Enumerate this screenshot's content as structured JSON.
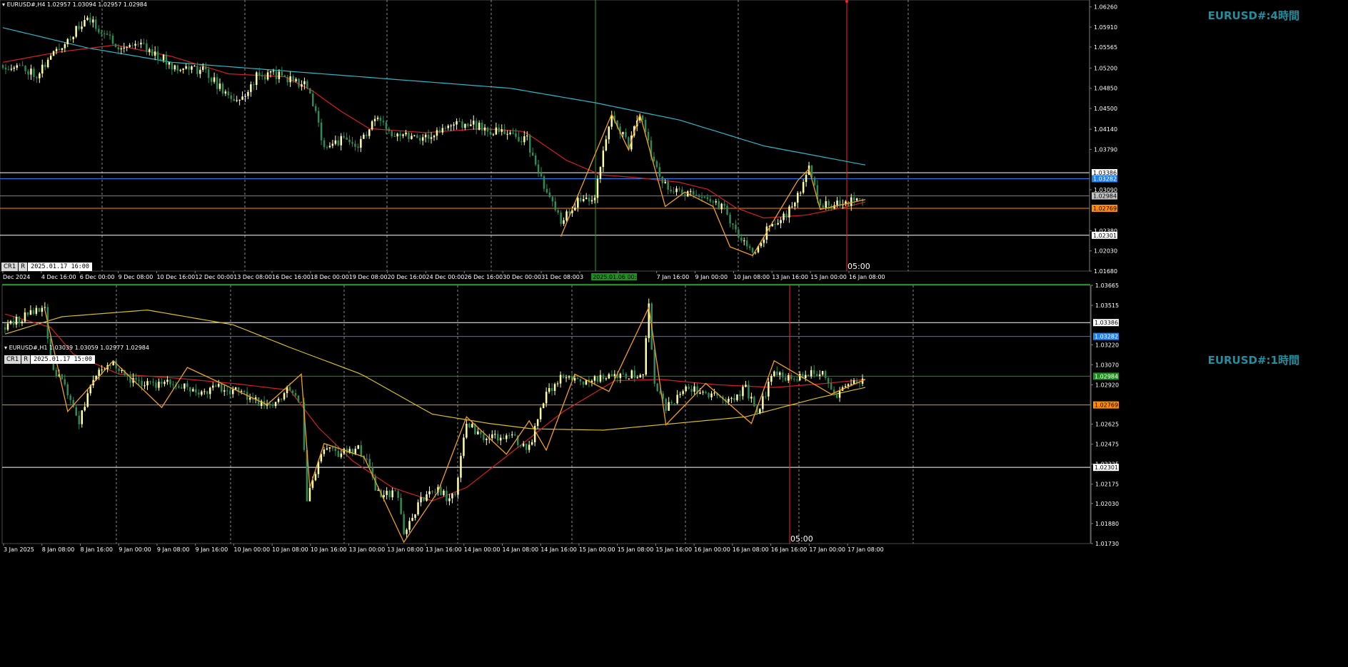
{
  "theme": {
    "background": "#000000",
    "grid_color": "#8a8a8a",
    "bull_candle": "#ffffaa",
    "bear_candle": "#2e8b57",
    "ma_fast": "#d42020",
    "ma_slow_h4": "#2fb7c9",
    "ma_slow_h1": "#d8c020",
    "zigzag": "#f0a020",
    "vline_red": "#ff2020",
    "vline_green": "#20a020"
  },
  "panels": [
    {
      "id": "h4",
      "header": "EURUSD#,H4  1.02957 1.03094 1.02957 1.02984",
      "title": "EURUSD#:4時間",
      "crosshair_chips": [
        "CR1",
        "R"
      ],
      "crosshair_time": "2025.01.17  16:00",
      "vline_label": "05:00",
      "highlight_time": "2025.01.06 00:00",
      "yticks": [
        "1.06260",
        "1.05910",
        "1.05565",
        "1.05200",
        "1.04850",
        "1.04500",
        "1.04140",
        "1.03790",
        "1.03090",
        "1.02380",
        "1.02030",
        "1.01680"
      ],
      "xticks": [
        "Dec 2024",
        "4 Dec 16:00",
        "6 Dec 00:00",
        "9 Dec 08:00",
        "10 Dec 16:00",
        "12 Dec 00:00",
        "13 Dec 08:00",
        "16 Dec 16:00",
        "18 Dec 00:00",
        "19 Dec 08:00",
        "20 Dec 16:00",
        "24 Dec 00:00",
        "26 Dec 16:00",
        "30 Dec 00:00",
        "31 Dec 08:00",
        "3",
        "08:00",
        "7 Jan 16:00",
        "9 Jan 00:00",
        "10 Jan 08:00",
        "13 Jan 16:00",
        "15 Jan 00:00",
        "16 Jan 08:00"
      ],
      "levels": [
        {
          "price": "1.03386",
          "color": "#ffffff",
          "tag_bg": "#ffffff",
          "tag_fg": "#000000"
        },
        {
          "price": "1.03282",
          "color": "#2080f0",
          "tag_bg": "#2080f0",
          "tag_fg": "#ffffff"
        },
        {
          "price": "1.02984",
          "color": "#7f7f7f",
          "tag_bg": "#c0c0c0",
          "tag_fg": "#000000"
        },
        {
          "price": "1.02769",
          "color": "#ff8c00",
          "tag_bg": "#ff8c00",
          "tag_fg": "#000000"
        },
        {
          "price": "1.02301",
          "color": "#ffffff",
          "tag_bg": "#ffffff",
          "tag_fg": "#000000"
        }
      ]
    },
    {
      "id": "h1",
      "header": "EURUSD#,H1  1.03039 1.03059 1.02977 1.02984",
      "title": "EURUSD#:1時間",
      "crosshair_chips": [
        "CR1",
        "R"
      ],
      "crosshair_time": "2025.01.17  15:00",
      "vline_label": "05:00",
      "yticks": [
        "1.03665",
        "1.03515",
        "1.03220",
        "1.03070",
        "1.02920",
        "1.02625",
        "1.02475",
        "1.02325",
        "1.02175",
        "1.02030",
        "1.01880",
        "1.01730"
      ],
      "xticks": [
        "3 Jan 2025",
        "8 Jan 08:00",
        "8 Jan 16:00",
        "9 Jan 00:00",
        "9 Jan 08:00",
        "9 Jan 16:00",
        "10 Jan 00:00",
        "10 Jan 08:00",
        "10 Jan 16:00",
        "13 Jan 00:00",
        "13 Jan 08:00",
        "13 Jan 16:00",
        "14 Jan 00:00",
        "14 Jan 08:00",
        "14 Jan 16:00",
        "15 Jan 00:00",
        "15 Jan 08:00",
        "15 Jan 16:00",
        "16 Jan 00:00",
        "16 Jan 08:00",
        "16 Jan 16:00",
        "17 Jan 00:00",
        "17 Jan 08:00"
      ],
      "levels": [
        {
          "price": "1.03386",
          "color": "#ffffff",
          "tag_bg": "#ffffff",
          "tag_fg": "#000000"
        },
        {
          "price": "1.03282",
          "color": "#2080f0",
          "tag_bg": "#2080f0",
          "tag_fg": "#ffffff"
        },
        {
          "price": "1.02984",
          "color": "#1f8f1f",
          "tag_bg": "#1f8f1f",
          "tag_fg": "#ffffff"
        },
        {
          "price": "1.02769",
          "color": "#ff8c00",
          "tag_bg": "#ff8c00",
          "tag_fg": "#000000"
        },
        {
          "price": "1.02301",
          "color": "#ffffff",
          "tag_bg": "#ffffff",
          "tag_fg": "#000000"
        }
      ]
    }
  ],
  "chart_data": [
    {
      "type": "candlestick",
      "symbol": "EURUSD#",
      "timeframe": "H4",
      "ylim": [
        1.0168,
        1.0638
      ],
      "close_path": [
        [
          0,
          1.0525
        ],
        [
          6,
          1.0522
        ],
        [
          12,
          1.051
        ],
        [
          18,
          1.0545
        ],
        [
          24,
          1.0575
        ],
        [
          30,
          1.0605
        ],
        [
          36,
          1.058
        ],
        [
          42,
          1.0555
        ],
        [
          48,
          1.0565
        ],
        [
          54,
          1.0545
        ],
        [
          60,
          1.0525
        ],
        [
          66,
          1.052
        ],
        [
          72,
          1.0515
        ],
        [
          78,
          1.048
        ],
        [
          84,
          1.046
        ],
        [
          90,
          1.0505
        ],
        [
          96,
          1.051
        ],
        [
          102,
          1.05
        ],
        [
          108,
          1.049
        ],
        [
          114,
          1.0385
        ],
        [
          120,
          1.0395
        ],
        [
          126,
          1.0385
        ],
        [
          132,
          1.043
        ],
        [
          138,
          1.041
        ],
        [
          144,
          1.0405
        ],
        [
          150,
          1.04
        ],
        [
          156,
          1.0412
        ],
        [
          162,
          1.0425
        ],
        [
          168,
          1.042
        ],
        [
          174,
          1.041
        ],
        [
          180,
          1.0405
        ],
        [
          186,
          1.0395
        ],
        [
          192,
          1.031
        ],
        [
          198,
          1.0255
        ],
        [
          204,
          1.029
        ],
        [
          210,
          1.03
        ],
        [
          216,
          1.044
        ],
        [
          222,
          1.0385
        ],
        [
          226,
          1.044
        ],
        [
          232,
          1.034
        ],
        [
          238,
          1.0305
        ],
        [
          244,
          1.03
        ],
        [
          250,
          1.0295
        ],
        [
          256,
          1.0275
        ],
        [
          262,
          1.022
        ],
        [
          266,
          1.02
        ],
        [
          272,
          1.0245
        ],
        [
          278,
          1.0265
        ],
        [
          282,
          1.03
        ],
        [
          286,
          1.0345
        ],
        [
          290,
          1.0285
        ],
        [
          296,
          1.0285
        ],
        [
          302,
          1.029
        ],
        [
          306,
          1.0298
        ]
      ],
      "ma_fast_path": [
        [
          0,
          1.053
        ],
        [
          20,
          1.0548
        ],
        [
          40,
          1.056
        ],
        [
          60,
          1.054
        ],
        [
          80,
          1.051
        ],
        [
          100,
          1.0505
        ],
        [
          110,
          1.048
        ],
        [
          120,
          1.0445
        ],
        [
          130,
          1.0415
        ],
        [
          150,
          1.0408
        ],
        [
          170,
          1.0415
        ],
        [
          185,
          1.041
        ],
        [
          200,
          1.036
        ],
        [
          212,
          1.0335
        ],
        [
          225,
          1.033
        ],
        [
          240,
          1.0322
        ],
        [
          250,
          1.031
        ],
        [
          260,
          1.0278
        ],
        [
          270,
          1.026
        ],
        [
          285,
          1.0265
        ],
        [
          300,
          1.028
        ],
        [
          306,
          1.0288
        ]
      ],
      "ma_slow_path": [
        [
          0,
          1.059
        ],
        [
          30,
          1.0555
        ],
        [
          60,
          1.053
        ],
        [
          100,
          1.0515
        ],
        [
          140,
          1.05
        ],
        [
          180,
          1.0485
        ],
        [
          210,
          1.046
        ],
        [
          240,
          1.043
        ],
        [
          270,
          1.0385
        ],
        [
          306,
          1.0352
        ]
      ],
      "zigzag": [
        [
          198,
          1.0228
        ],
        [
          216,
          1.044
        ],
        [
          222,
          1.0378
        ],
        [
          226,
          1.044
        ],
        [
          235,
          1.028
        ],
        [
          242,
          1.0305
        ],
        [
          252,
          1.028
        ],
        [
          258,
          1.021
        ],
        [
          266,
          1.0195
        ],
        [
          282,
          1.0325
        ],
        [
          286,
          1.0345
        ],
        [
          290,
          1.0275
        ],
        [
          306,
          1.0292
        ]
      ],
      "x_count": 306
    },
    {
      "type": "candlestick",
      "symbol": "EURUSD#",
      "timeframe": "H1",
      "ylim": [
        1.0173,
        1.03665
      ],
      "close_path": [
        [
          0,
          1.0335
        ],
        [
          8,
          1.0345
        ],
        [
          14,
          1.0348
        ],
        [
          16,
          1.031
        ],
        [
          22,
          1.0285
        ],
        [
          26,
          1.0265
        ],
        [
          32,
          1.03
        ],
        [
          38,
          1.031
        ],
        [
          44,
          1.0295
        ],
        [
          52,
          1.0293
        ],
        [
          60,
          1.0293
        ],
        [
          68,
          1.0286
        ],
        [
          76,
          1.029
        ],
        [
          84,
          1.0285
        ],
        [
          92,
          1.0275
        ],
        [
          100,
          1.029
        ],
        [
          104,
          1.028
        ],
        [
          106,
          1.0205
        ],
        [
          112,
          1.0245
        ],
        [
          118,
          1.024
        ],
        [
          124,
          1.0245
        ],
        [
          128,
          1.0232
        ],
        [
          130,
          1.021
        ],
        [
          138,
          1.021
        ],
        [
          140,
          1.018
        ],
        [
          146,
          1.0205
        ],
        [
          152,
          1.0215
        ],
        [
          156,
          1.0205
        ],
        [
          158,
          1.0212
        ],
        [
          162,
          1.0265
        ],
        [
          168,
          1.025
        ],
        [
          176,
          1.0255
        ],
        [
          184,
          1.0245
        ],
        [
          190,
          1.0285
        ],
        [
          196,
          1.03
        ],
        [
          202,
          1.0295
        ],
        [
          210,
          1.0298
        ],
        [
          218,
          1.03
        ],
        [
          224,
          1.03
        ],
        [
          226,
          1.035
        ],
        [
          228,
          1.029
        ],
        [
          232,
          1.0275
        ],
        [
          240,
          1.029
        ],
        [
          248,
          1.0285
        ],
        [
          256,
          1.028
        ],
        [
          260,
          1.029
        ],
        [
          264,
          1.027
        ],
        [
          270,
          1.0302
        ],
        [
          276,
          1.0295
        ],
        [
          282,
          1.03
        ],
        [
          288,
          1.03
        ],
        [
          292,
          1.0282
        ],
        [
          296,
          1.0292
        ],
        [
          302,
          1.0298
        ]
      ],
      "ma_fast_path": [
        [
          0,
          1.0345
        ],
        [
          16,
          1.0335
        ],
        [
          24,
          1.0315
        ],
        [
          40,
          1.03
        ],
        [
          60,
          1.0297
        ],
        [
          80,
          1.0293
        ],
        [
          100,
          1.0288
        ],
        [
          110,
          1.026
        ],
        [
          122,
          1.0235
        ],
        [
          136,
          1.0215
        ],
        [
          150,
          1.0205
        ],
        [
          162,
          1.0215
        ],
        [
          180,
          1.0245
        ],
        [
          196,
          1.0272
        ],
        [
          214,
          1.0295
        ],
        [
          230,
          1.0296
        ],
        [
          250,
          1.0292
        ],
        [
          270,
          1.029
        ],
        [
          288,
          1.0293
        ],
        [
          302,
          1.0296
        ]
      ],
      "ma_slow_path": [
        [
          0,
          1.033
        ],
        [
          20,
          1.0343
        ],
        [
          50,
          1.0348
        ],
        [
          80,
          1.0337
        ],
        [
          100,
          1.032
        ],
        [
          125,
          1.03
        ],
        [
          150,
          1.027
        ],
        [
          170,
          1.0263
        ],
        [
          185,
          1.0259
        ],
        [
          210,
          1.0258
        ],
        [
          230,
          1.0262
        ],
        [
          260,
          1.0268
        ],
        [
          285,
          1.0282
        ],
        [
          302,
          1.029
        ]
      ],
      "zigzag": [
        [
          14,
          1.0348
        ],
        [
          22,
          1.0272
        ],
        [
          38,
          1.031
        ],
        [
          55,
          1.0275
        ],
        [
          64,
          1.0305
        ],
        [
          92,
          1.0277
        ],
        [
          104,
          1.03
        ],
        [
          107,
          1.0215
        ],
        [
          112,
          1.0248
        ],
        [
          126,
          1.0238
        ],
        [
          140,
          1.0174
        ],
        [
          152,
          1.0212
        ],
        [
          162,
          1.0268
        ],
        [
          176,
          1.024
        ],
        [
          184,
          1.0265
        ],
        [
          190,
          1.0243
        ],
        [
          200,
          1.03
        ],
        [
          212,
          1.0287
        ],
        [
          226,
          1.035
        ],
        [
          232,
          1.0262
        ],
        [
          246,
          1.0293
        ],
        [
          262,
          1.0263
        ],
        [
          270,
          1.031
        ],
        [
          290,
          1.0285
        ],
        [
          302,
          1.0296
        ]
      ],
      "x_count": 302
    }
  ]
}
